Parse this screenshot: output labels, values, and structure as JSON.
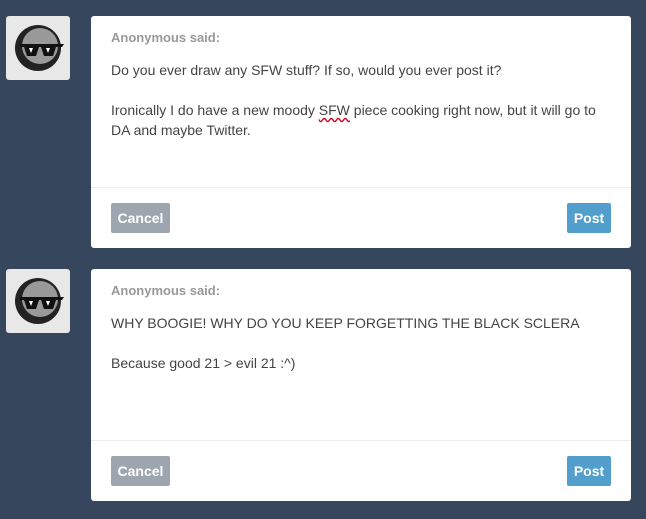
{
  "posts": [
    {
      "asker": "Anonymous said:",
      "question": "Do you ever draw any SFW stuff? If so, would you ever post it?",
      "answer_before": "Ironically I do have a new moody ",
      "answer_marked": "SFW",
      "answer_after": " piece cooking right now, but it will go to DA and maybe Twitter.",
      "cancel_label": "Cancel",
      "post_label": "Post"
    },
    {
      "asker": "Anonymous said:",
      "question": "WHY BOOGIE! WHY DO YOU KEEP FORGETTING THE BLACK SCLERA",
      "answer": "Because good 21 > evil 21 :^)",
      "cancel_label": "Cancel",
      "post_label": "Post"
    }
  ],
  "colors": {
    "background": "#36465d",
    "post_button": "#529ecc",
    "cancel_button": "#9da6af"
  },
  "icons": {
    "avatar": "anonymous-sunglasses-avatar-icon"
  }
}
